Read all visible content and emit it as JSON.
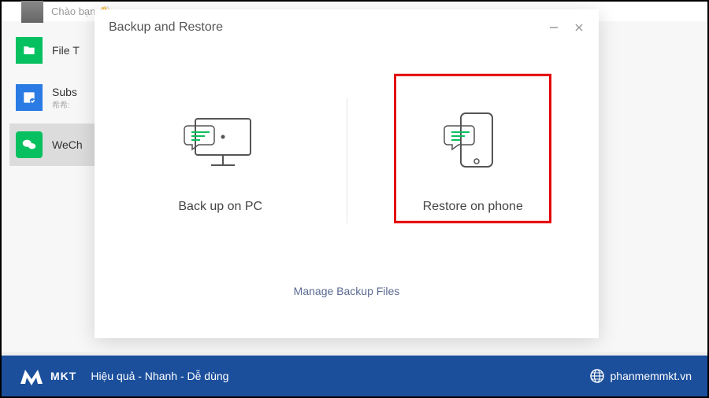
{
  "background": {
    "greeting": "Chào bạn 👋",
    "sidebar_items": [
      {
        "label": "File T",
        "sub": ""
      },
      {
        "label": "Subs",
        "sub": "希希:"
      },
      {
        "label": "WeCh",
        "sub": ""
      }
    ]
  },
  "dialog": {
    "title": "Backup and Restore",
    "option_backup_label": "Back up on PC",
    "option_restore_label": "Restore on phone",
    "footer_link": "Manage Backup Files"
  },
  "footer": {
    "logo_text": "MKT",
    "tagline": "Hiệu quả - Nhanh - Dễ dùng",
    "url": "phanmemmkt.vn"
  }
}
